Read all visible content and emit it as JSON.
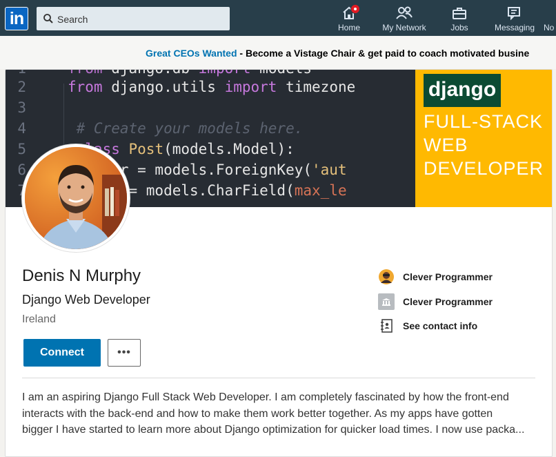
{
  "nav": {
    "logo": "in",
    "search_placeholder": "Search",
    "items": [
      {
        "label": "Home",
        "icon": "home-icon",
        "has_badge": true
      },
      {
        "label": "My Network",
        "icon": "network-icon"
      },
      {
        "label": "Jobs",
        "icon": "briefcase-icon"
      },
      {
        "label": "Messaging",
        "icon": "messaging-icon"
      },
      {
        "label": "No",
        "icon": "notifications-icon"
      }
    ]
  },
  "ad": {
    "link_text": "Great CEOs Wanted",
    "separator": " - ",
    "text": "Become a Vistage Chair & get paid to coach motivated busine"
  },
  "banner": {
    "code_lines": [
      {
        "n": "1",
        "text": "from django.db import models"
      },
      {
        "n": "2",
        "text": "from django.utils import timezone"
      },
      {
        "n": "3",
        "text": ""
      },
      {
        "n": "4",
        "text": "# Create your models here."
      },
      {
        "n": "5",
        "text": "class Post(models.Model):"
      },
      {
        "n": "6",
        "text": "author = models.ForeignKey('aut"
      },
      {
        "n": "7",
        "text": "title = models.CharField(max_le"
      }
    ],
    "promo_logo": "django",
    "promo_lines": [
      "FULL-STACK",
      "WEB",
      "DEVELOPER"
    ]
  },
  "profile": {
    "name": "Denis N Murphy",
    "headline": "Django Web Developer",
    "location": "Ireland",
    "connect_label": "Connect",
    "more_label": "•••",
    "side": [
      {
        "label": "Clever Programmer",
        "icon": "company-logo-icon"
      },
      {
        "label": "Clever Programmer",
        "icon": "school-icon"
      },
      {
        "label": "See contact info",
        "icon": "contact-card-icon"
      }
    ],
    "about_lines": [
      "I am an aspiring Django Full Stack Web Developer. I am completely fascinated by how the front-end",
      "interacts with the back-end and how to make them work better together. As my apps have gotten",
      "bigger I have started to learn more about Django optimization for quicker load times. I now use packa..."
    ]
  },
  "colors": {
    "nav_bg": "#283e4a",
    "accent": "#0073b1",
    "promo_bg": "#ffb901",
    "django_green": "#0c4b33"
  }
}
